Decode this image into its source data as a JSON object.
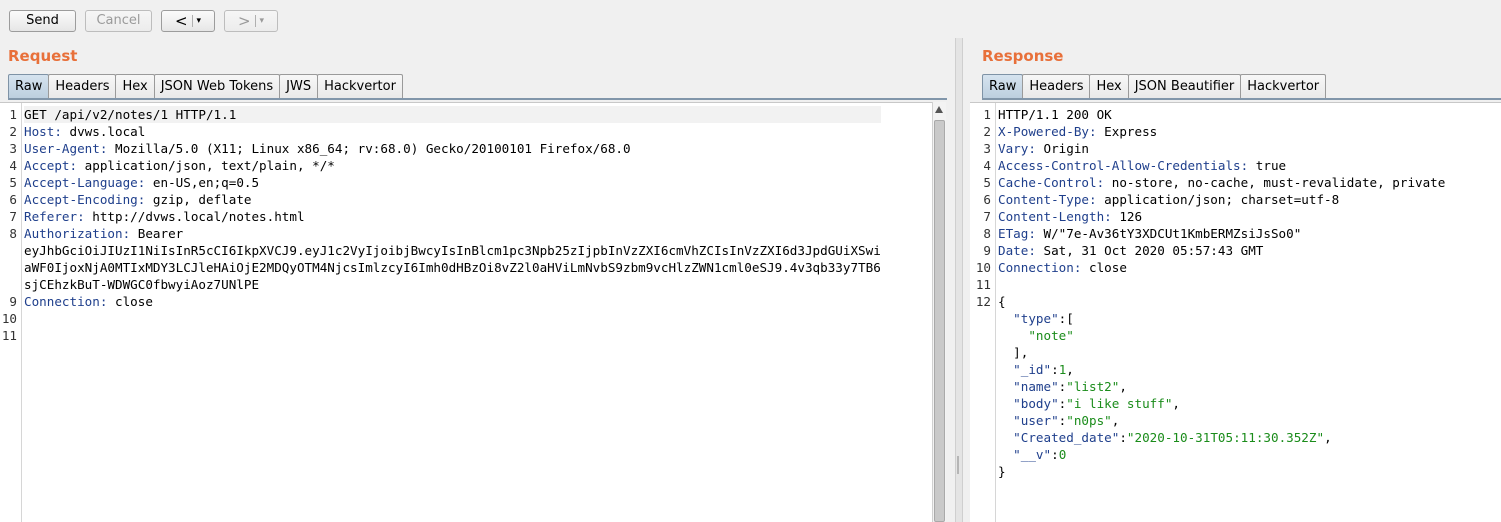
{
  "toolbar": {
    "send_label": "Send",
    "cancel_label": "Cancel",
    "back_label": "<",
    "forward_label": ">",
    "dropdown_glyph": "▾"
  },
  "request": {
    "title": "Request",
    "tabs": [
      "Raw",
      "Headers",
      "Hex",
      "JSON Web Tokens",
      "JWS",
      "Hackvertor"
    ],
    "active_tab": "Raw",
    "lines": [
      {
        "n": "1",
        "name": "",
        "value": "GET /api/v2/notes/1 HTTP/1.1"
      },
      {
        "n": "2",
        "name": "Host:",
        "value": " dvws.local"
      },
      {
        "n": "3",
        "name": "User-Agent:",
        "value": " Mozilla/5.0 (X11; Linux x86_64; rv:68.0) Gecko/20100101 Firefox/68.0"
      },
      {
        "n": "4",
        "name": "Accept:",
        "value": " application/json, text/plain, */*"
      },
      {
        "n": "5",
        "name": "Accept-Language:",
        "value": " en-US,en;q=0.5"
      },
      {
        "n": "6",
        "name": "Accept-Encoding:",
        "value": " gzip, deflate"
      },
      {
        "n": "7",
        "name": "Referer:",
        "value": " http://dvws.local/notes.html"
      },
      {
        "n": "8",
        "name": "Authorization:",
        "value": " Bearer"
      },
      {
        "n": "",
        "name": "",
        "value": "eyJhbGciOiJIUzI1NiIsInR5cCI6IkpXVCJ9.eyJ1c2VyIjoibjBwcyIsInBlcm1pc3Npb25zIjpbInVzZXI6cmVhZCIsInVzZXI6d3JpdGUiXSwi"
      },
      {
        "n": "",
        "name": "",
        "value": "aWF0IjoxNjA0MTIxMDY3LCJleHAiOjE2MDQyOTM4NjcsImlzcyI6Imh0dHBzOi8vZ2l0aHViLmNvbS9zbm9vcHlzZWN1cml0eSJ9.4v3qb33y7TB6"
      },
      {
        "n": "",
        "name": "",
        "value": "sjCEhzkBuT-WDWGC0fbwyiAoz7UNlPE"
      },
      {
        "n": "9",
        "name": "Connection:",
        "value": " close"
      },
      {
        "n": "10",
        "name": "",
        "value": ""
      },
      {
        "n": "11",
        "name": "",
        "value": ""
      }
    ]
  },
  "response": {
    "title": "Response",
    "tabs": [
      "Raw",
      "Headers",
      "Hex",
      "JSON Beautifier",
      "Hackvertor"
    ],
    "active_tab": "Raw",
    "header_lines": [
      {
        "n": "1",
        "name": "",
        "value": "HTTP/1.1 200 OK"
      },
      {
        "n": "2",
        "name": "X-Powered-By:",
        "value": " Express"
      },
      {
        "n": "3",
        "name": "Vary:",
        "value": " Origin"
      },
      {
        "n": "4",
        "name": "Access-Control-Allow-Credentials:",
        "value": " true"
      },
      {
        "n": "5",
        "name": "Cache-Control:",
        "value": " no-store, no-cache, must-revalidate, private"
      },
      {
        "n": "6",
        "name": "Content-Type:",
        "value": " application/json; charset=utf-8"
      },
      {
        "n": "7",
        "name": "Content-Length:",
        "value": " 126"
      },
      {
        "n": "8",
        "name": "ETag:",
        "value": " W/\"7e-Av36tY3XDCUt1KmbERMZsiJsSo0\""
      },
      {
        "n": "9",
        "name": "Date:",
        "value": " Sat, 31 Oct 2020 05:57:43 GMT"
      },
      {
        "n": "10",
        "name": "Connection:",
        "value": " close"
      },
      {
        "n": "11",
        "name": "",
        "value": ""
      }
    ],
    "body_lines": [
      {
        "n": "12",
        "indent": "",
        "key": "",
        "sep": "",
        "val": "",
        "tail": "{"
      },
      {
        "n": "",
        "indent": "  ",
        "key": "\"type\"",
        "sep": ":",
        "val": "",
        "tail": "["
      },
      {
        "n": "",
        "indent": "    ",
        "key": "",
        "sep": "",
        "val": "\"note\"",
        "tail": ""
      },
      {
        "n": "",
        "indent": "  ",
        "key": "",
        "sep": "",
        "val": "",
        "tail": "],"
      },
      {
        "n": "",
        "indent": "  ",
        "key": "\"_id\"",
        "sep": ":",
        "val": "1",
        "tail": ","
      },
      {
        "n": "",
        "indent": "  ",
        "key": "\"name\"",
        "sep": ":",
        "val": "\"list2\"",
        "tail": ","
      },
      {
        "n": "",
        "indent": "  ",
        "key": "\"body\"",
        "sep": ":",
        "val": "\"i like stuff\"",
        "tail": ","
      },
      {
        "n": "",
        "indent": "  ",
        "key": "\"user\"",
        "sep": ":",
        "val": "\"n0ps\"",
        "tail": ","
      },
      {
        "n": "",
        "indent": "  ",
        "key": "\"Created_date\"",
        "sep": ":",
        "val": "\"2020-10-31T05:11:30.352Z\"",
        "tail": ","
      },
      {
        "n": "",
        "indent": "  ",
        "key": "\"__v\"",
        "sep": ":",
        "val": "0",
        "tail": ""
      },
      {
        "n": "",
        "indent": "",
        "key": "",
        "sep": "",
        "val": "",
        "tail": "}"
      }
    ]
  },
  "colors": {
    "title_orange": "#e8703a",
    "header_name_blue": "#1f3f8c",
    "json_value_green": "#1a8c1a",
    "active_tab_blue": "#bccfdf"
  }
}
